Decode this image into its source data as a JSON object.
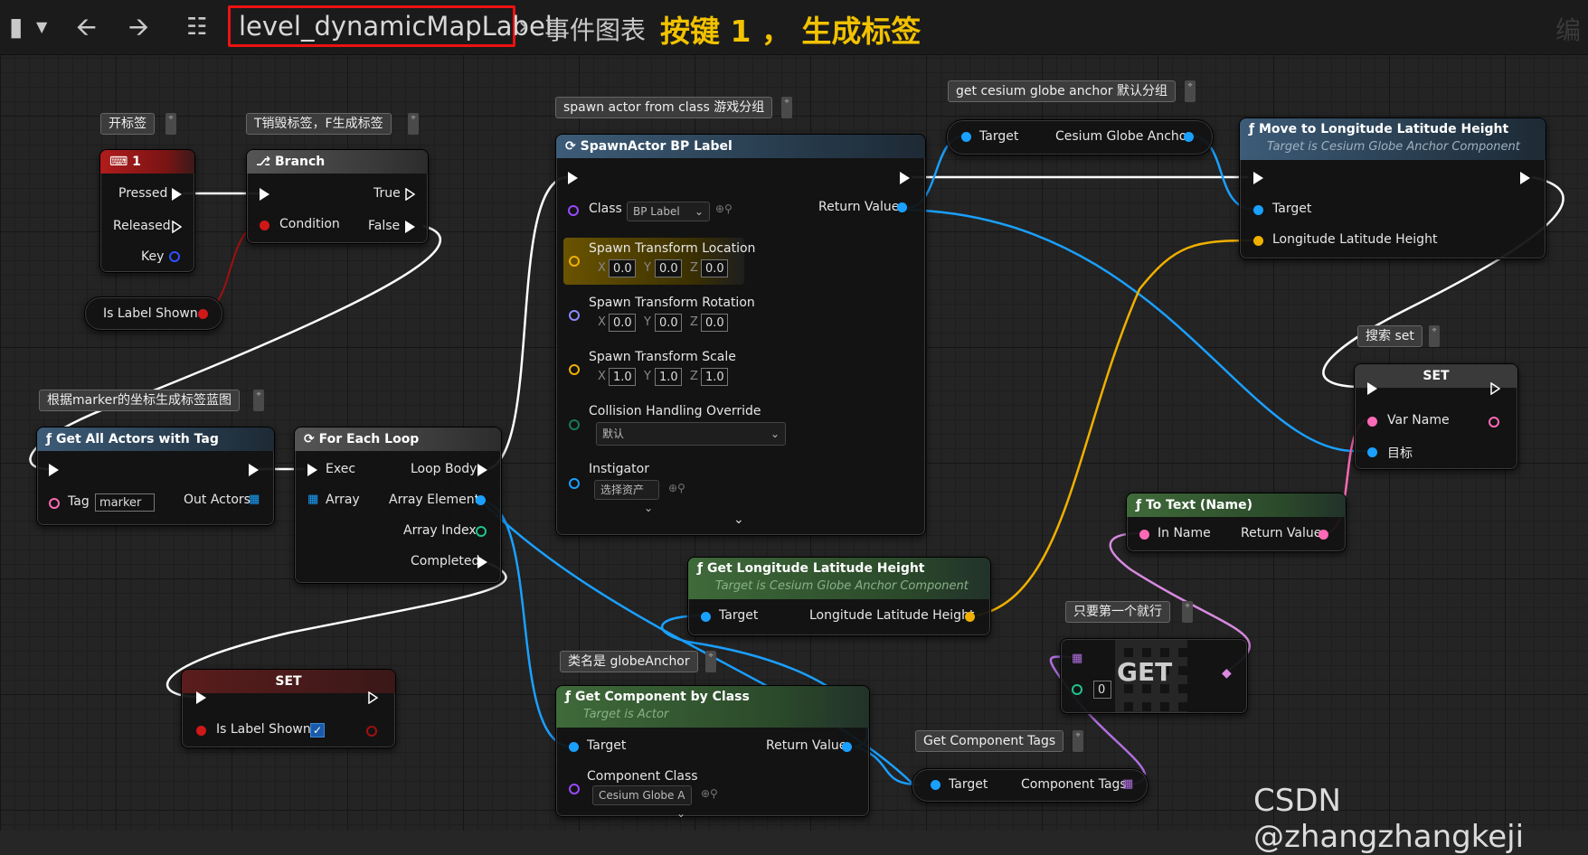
{
  "topbar": {
    "crumb_level": "level_dynamicMapLabel",
    "crumb_graph": "事件图表",
    "crumb_title": "按键 1 ， 生成标签",
    "crumb_right": "编"
  },
  "comments": {
    "open_label": "开标签",
    "toggle_label": "T销毁标签，F生成标签",
    "spawn_actor": "spawn actor from class 游戏分组",
    "cesium_anchor": "get cesium globe anchor 默认分组",
    "marker_bp": "根据marker的坐标生成标签蓝图",
    "search_set": "搜索 set",
    "first_only": "只要第一个就行",
    "class_global": "类名是 globeAnchor",
    "get_tags": "Get Component Tags"
  },
  "key_node": {
    "title": "1",
    "pressed": "Pressed",
    "released": "Released",
    "key": "Key"
  },
  "is_label_shown": {
    "label": "Is Label Shown"
  },
  "branch": {
    "title": "Branch",
    "condition": "Condition",
    "true": "True",
    "false": "False"
  },
  "spawn": {
    "title": "SpawnActor BP Label",
    "class": "Class",
    "class_value": "BP Label",
    "return_value": "Return Value",
    "loc": "Spawn Transform Location",
    "loc_x": "0.0",
    "loc_y": "0.0",
    "loc_z": "0.0",
    "rot": "Spawn Transform Rotation",
    "rot_x": "0.0",
    "rot_y": "0.0",
    "rot_z": "0.0",
    "scale": "Spawn Transform Scale",
    "sc_x": "1.0",
    "sc_y": "1.0",
    "sc_z": "1.0",
    "collision": "Collision Handling Override",
    "collision_value": "默认",
    "instigator": "Instigator",
    "instigator_value": "选择资产",
    "axis_x": "X",
    "axis_y": "Y",
    "axis_z": "Z"
  },
  "cesium_node": {
    "target": "Target",
    "anchor": "Cesium Globe Anchor"
  },
  "move_node": {
    "title": "Move to Longitude Latitude Height",
    "subtitle": "Target is Cesium Globe Anchor Component",
    "target": "Target",
    "llh": "Longitude Latitude Height"
  },
  "get_all": {
    "title": "Get All Actors with Tag",
    "tag": "Tag",
    "tag_value": "marker",
    "out_actors": "Out Actors"
  },
  "for_each": {
    "title": "For Each Loop",
    "exec": "Exec",
    "array": "Array",
    "loop_body": "Loop Body",
    "array_element": "Array Element",
    "array_index": "Array Index",
    "completed": "Completed"
  },
  "set_node": {
    "title": "SET",
    "var_name": "Var Name",
    "target": "目标"
  },
  "to_text": {
    "title": "To Text (Name)",
    "in_name": "In Name",
    "return_value": "Return Value"
  },
  "get_llh": {
    "title": "Get Longitude Latitude Height",
    "subtitle": "Target is Cesium Globe Anchor Component",
    "target": "Target",
    "llh": "Longitude Latitude Height"
  },
  "get_array": {
    "title": "GET",
    "index": "0"
  },
  "get_comp": {
    "title": "Get Component by Class",
    "subtitle": "Target is Actor",
    "target": "Target",
    "return_value": "Return Value",
    "comp_class": "Component Class",
    "comp_value": "Cesium Globe A"
  },
  "comp_tags": {
    "target": "Target",
    "tags": "Component Tags"
  },
  "set_shown": {
    "title": "SET",
    "label": "Is Label Shown"
  },
  "watermark": "CSDN @zhangzhangkeji"
}
